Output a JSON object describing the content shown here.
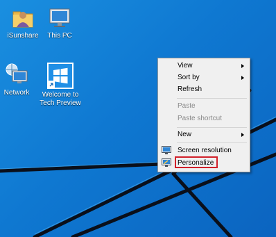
{
  "desktop": {
    "icons": [
      {
        "label": "iSunshare",
        "icon": "user-folder-icon"
      },
      {
        "label": "This PC",
        "icon": "computer-icon"
      },
      {
        "label": "Network",
        "icon": "network-icon"
      },
      {
        "label": "Welcome to Tech Preview",
        "label_line1": "Welcome to",
        "label_line2": "Tech Preview",
        "icon": "windows-logo-icon"
      }
    ]
  },
  "context_menu": {
    "items": [
      {
        "label": "View",
        "has_submenu": true
      },
      {
        "label": "Sort by",
        "has_submenu": true
      },
      {
        "label": "Refresh",
        "has_submenu": false
      },
      {
        "label": "Paste",
        "disabled": true
      },
      {
        "label": "Paste shortcut",
        "disabled": true
      },
      {
        "label": "New",
        "has_submenu": true
      },
      {
        "label": "Screen resolution",
        "icon": "display-settings-icon"
      },
      {
        "label": "Personalize",
        "icon": "personalize-icon",
        "highlighted": true
      }
    ]
  },
  "colors": {
    "desktop_blue": "#0f78d1",
    "highlight_border": "#d1202a",
    "menu_background": "#f0f0f0"
  }
}
